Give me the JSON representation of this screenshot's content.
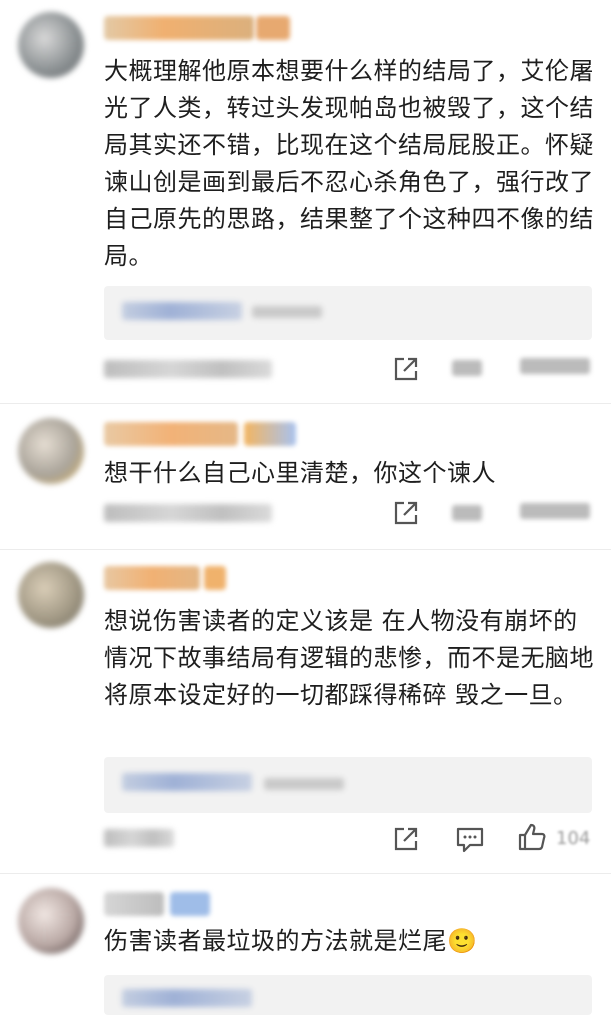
{
  "comments": [
    {
      "body": "大概理解他原本想要什么样的结局了，艾伦屠光了人类，转过头发现帕岛也被毁了，这个结局其实还不错，比现在这个结局屁股正。怀疑谏山创是画到最后不忍心杀角色了，强行改了自己原先的思路，结果整了个这种四不像的结局。"
    },
    {
      "body": "想干什么自己心里清楚，你这个谏人"
    },
    {
      "body": "想说伤害读者的定义该是 在人物没有崩坏的情况下故事结局有逻辑的悲惨，而不是无脑地将原本设定好的一切都踩得稀碎 毁之一旦。",
      "like_count": "104"
    },
    {
      "body": "伤害读者最垃圾的方法就是烂尾🙂"
    }
  ],
  "icons": {
    "share": "share-icon",
    "comment": "comment-icon",
    "like": "thumbs-up-icon"
  },
  "colors": {
    "text": "#1e1e1e",
    "reply_bg": "#f2f2f2",
    "icon": "#555555"
  }
}
